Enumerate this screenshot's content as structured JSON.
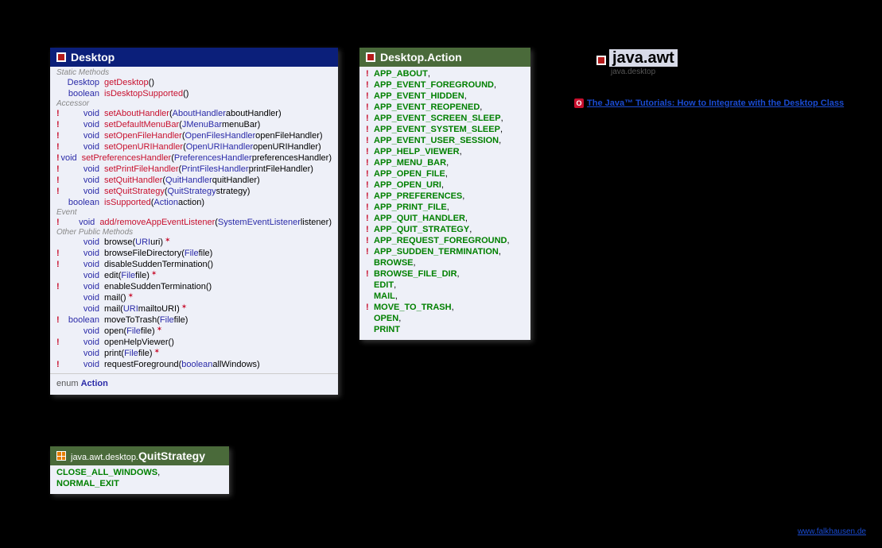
{
  "package": {
    "name": "java.awt",
    "module": "java.desktop"
  },
  "tutorial": {
    "label": "The Java™ Tutorials: How to Integrate with the Desktop Class"
  },
  "site": "www.falkhausen.de",
  "desktop": {
    "title": "Desktop",
    "sections": {
      "static": "Static Methods",
      "accessor": "Accessor",
      "event": "Event",
      "other": "Other Public Methods"
    },
    "static_methods": [
      {
        "bang": "",
        "ret": "Desktop",
        "name": "getDesktop",
        "name_red": true,
        "params": []
      },
      {
        "bang": "",
        "ret": "boolean",
        "name": "isDesktopSupported",
        "name_red": true,
        "params": []
      }
    ],
    "accessors": [
      {
        "bang": "!",
        "ret": "void",
        "name": "setAboutHandler",
        "name_red": true,
        "params": [
          {
            "type": "AboutHandler",
            "name": "aboutHandler"
          }
        ]
      },
      {
        "bang": "!",
        "ret": "void",
        "name": "setDefaultMenuBar",
        "name_red": true,
        "params": [
          {
            "type": "JMenuBar",
            "name": "menuBar"
          }
        ]
      },
      {
        "bang": "!",
        "ret": "void",
        "name": "setOpenFileHandler",
        "name_red": true,
        "params": [
          {
            "type": "OpenFilesHandler",
            "name": "openFileHandler"
          }
        ]
      },
      {
        "bang": "!",
        "ret": "void",
        "name": "setOpenURIHandler",
        "name_red": true,
        "params": [
          {
            "type": "OpenURIHandler",
            "name": "openURIHandler"
          }
        ]
      },
      {
        "bang": "!",
        "ret": "void",
        "name": "setPreferencesHandler",
        "name_red": true,
        "params": [
          {
            "type": "PreferencesHandler",
            "name": "preferencesHandler"
          }
        ]
      },
      {
        "bang": "!",
        "ret": "void",
        "name": "setPrintFileHandler",
        "name_red": true,
        "params": [
          {
            "type": "PrintFilesHandler",
            "name": "printFileHandler"
          }
        ]
      },
      {
        "bang": "!",
        "ret": "void",
        "name": "setQuitHandler",
        "name_red": true,
        "params": [
          {
            "type": "QuitHandler",
            "name": "quitHandler"
          }
        ]
      },
      {
        "bang": "!",
        "ret": "void",
        "name": "setQuitStrategy",
        "name_red": true,
        "params": [
          {
            "type": "QuitStrategy",
            "name": "strategy"
          }
        ]
      },
      {
        "bang": "",
        "ret": "boolean",
        "name": "isSupported",
        "name_red": true,
        "params": [
          {
            "type": "Action",
            "name": "action"
          }
        ]
      }
    ],
    "events": [
      {
        "bang": "!",
        "ret": "void",
        "name": "add/removeAppEventListener",
        "name_red": true,
        "params": [
          {
            "type": "SystemEventListener",
            "name": "listener"
          }
        ]
      }
    ],
    "other": [
      {
        "bang": "",
        "ret": "void",
        "name": "browse",
        "params": [
          {
            "type": "URI",
            "name": "uri"
          }
        ],
        "throws": true
      },
      {
        "bang": "!",
        "ret": "void",
        "name": "browseFileDirectory",
        "params": [
          {
            "type": "File",
            "name": "file"
          }
        ]
      },
      {
        "bang": "!",
        "ret": "void",
        "name": "disableSuddenTermination",
        "params": []
      },
      {
        "bang": "",
        "ret": "void",
        "name": "edit",
        "params": [
          {
            "type": "File",
            "name": "file"
          }
        ],
        "throws": true
      },
      {
        "bang": "!",
        "ret": "void",
        "name": "enableSuddenTermination",
        "params": []
      },
      {
        "bang": "",
        "ret": "void",
        "name": "mail",
        "params": [],
        "throws": true
      },
      {
        "bang": "",
        "ret": "void",
        "name": "mail",
        "params": [
          {
            "type": "URI",
            "name": "mailtoURI"
          }
        ],
        "throws": true
      },
      {
        "bang": "!",
        "ret": "boolean",
        "name": "moveToTrash",
        "params": [
          {
            "type": "File",
            "name": "file"
          }
        ]
      },
      {
        "bang": "",
        "ret": "void",
        "name": "open",
        "params": [
          {
            "type": "File",
            "name": "file"
          }
        ],
        "throws": true
      },
      {
        "bang": "!",
        "ret": "void",
        "name": "openHelpViewer",
        "params": []
      },
      {
        "bang": "",
        "ret": "void",
        "name": "print",
        "params": [
          {
            "type": "File",
            "name": "file"
          }
        ],
        "throws": true
      },
      {
        "bang": "!",
        "ret": "void",
        "name": "requestForeground",
        "params": [
          {
            "type": "boolean",
            "name": "allWindows"
          }
        ]
      }
    ],
    "footer": {
      "kw": "enum",
      "name": "Action"
    }
  },
  "action": {
    "title": "Desktop.Action",
    "values": [
      {
        "bang": "!",
        "val": "APP_ABOUT",
        "comma": true
      },
      {
        "bang": "!",
        "val": "APP_EVENT_FOREGROUND",
        "comma": true
      },
      {
        "bang": "!",
        "val": "APP_EVENT_HIDDEN",
        "comma": true
      },
      {
        "bang": "!",
        "val": "APP_EVENT_REOPENED",
        "comma": true
      },
      {
        "bang": "!",
        "val": "APP_EVENT_SCREEN_SLEEP",
        "comma": true
      },
      {
        "bang": "!",
        "val": "APP_EVENT_SYSTEM_SLEEP",
        "comma": true
      },
      {
        "bang": "!",
        "val": "APP_EVENT_USER_SESSION",
        "comma": true
      },
      {
        "bang": "!",
        "val": "APP_HELP_VIEWER",
        "comma": true
      },
      {
        "bang": "!",
        "val": "APP_MENU_BAR",
        "comma": true
      },
      {
        "bang": "!",
        "val": "APP_OPEN_FILE",
        "comma": true
      },
      {
        "bang": "!",
        "val": "APP_OPEN_URI",
        "comma": true
      },
      {
        "bang": "!",
        "val": "APP_PREFERENCES",
        "comma": true
      },
      {
        "bang": "!",
        "val": "APP_PRINT_FILE",
        "comma": true
      },
      {
        "bang": "!",
        "val": "APP_QUIT_HANDLER",
        "comma": true
      },
      {
        "bang": "!",
        "val": "APP_QUIT_STRATEGY",
        "comma": true
      },
      {
        "bang": "!",
        "val": "APP_REQUEST_FOREGROUND",
        "comma": true
      },
      {
        "bang": "!",
        "val": "APP_SUDDEN_TERMINATION",
        "comma": true
      },
      {
        "bang": "",
        "val": "BROWSE",
        "comma": true
      },
      {
        "bang": "!",
        "val": "BROWSE_FILE_DIR",
        "comma": true
      },
      {
        "bang": "",
        "val": "EDIT",
        "comma": true
      },
      {
        "bang": "",
        "val": "MAIL",
        "comma": true
      },
      {
        "bang": "!",
        "val": "MOVE_TO_TRASH",
        "comma": true
      },
      {
        "bang": "",
        "val": "OPEN",
        "comma": true
      },
      {
        "bang": "",
        "val": "PRINT",
        "comma": false
      }
    ]
  },
  "quitstrategy": {
    "prefix": "java.awt.desktop.",
    "title": "QuitStrategy",
    "values": [
      {
        "val": "CLOSE_ALL_WINDOWS",
        "comma": true
      },
      {
        "val": "NORMAL_EXIT",
        "comma": false
      }
    ]
  }
}
